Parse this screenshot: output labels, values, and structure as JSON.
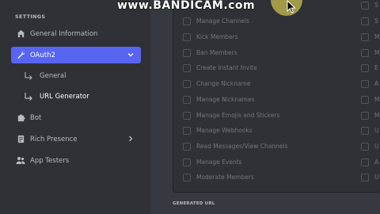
{
  "watermark": "www.BANDICAM.com",
  "sidebar": {
    "header": "SETTINGS",
    "items": [
      {
        "label": "General Information",
        "icon": "home-icon"
      },
      {
        "label": "OAuth2",
        "icon": "wrench-icon",
        "active": true
      },
      {
        "label": "Bot",
        "icon": "puzzle-icon"
      },
      {
        "label": "Rich Presence",
        "icon": "document-icon"
      },
      {
        "label": "App Testers",
        "icon": "users-icon"
      }
    ],
    "sub_items": [
      {
        "label": "General"
      },
      {
        "label": "URL Generator",
        "active": true
      }
    ]
  },
  "scopes": [
    "Manage Channels",
    "Kick Members",
    "Ban Members",
    "Create Instant Invite",
    "Change Nickname",
    "Manage Nicknames",
    "Manage Emojis and Stickers",
    "Manage Webhooks",
    "Read Messages/View Channels",
    "Manage Events",
    "Moderate Members"
  ],
  "scopes_right": [
    "S",
    "S",
    "M",
    "M",
    "E",
    "A",
    "M",
    "M",
    "U",
    "U",
    "A",
    "U"
  ],
  "generated_url_label": "GENERATED URL",
  "colors": {
    "accent": "#5865f2",
    "sidebar": "#2f3136",
    "main": "#36393f"
  }
}
